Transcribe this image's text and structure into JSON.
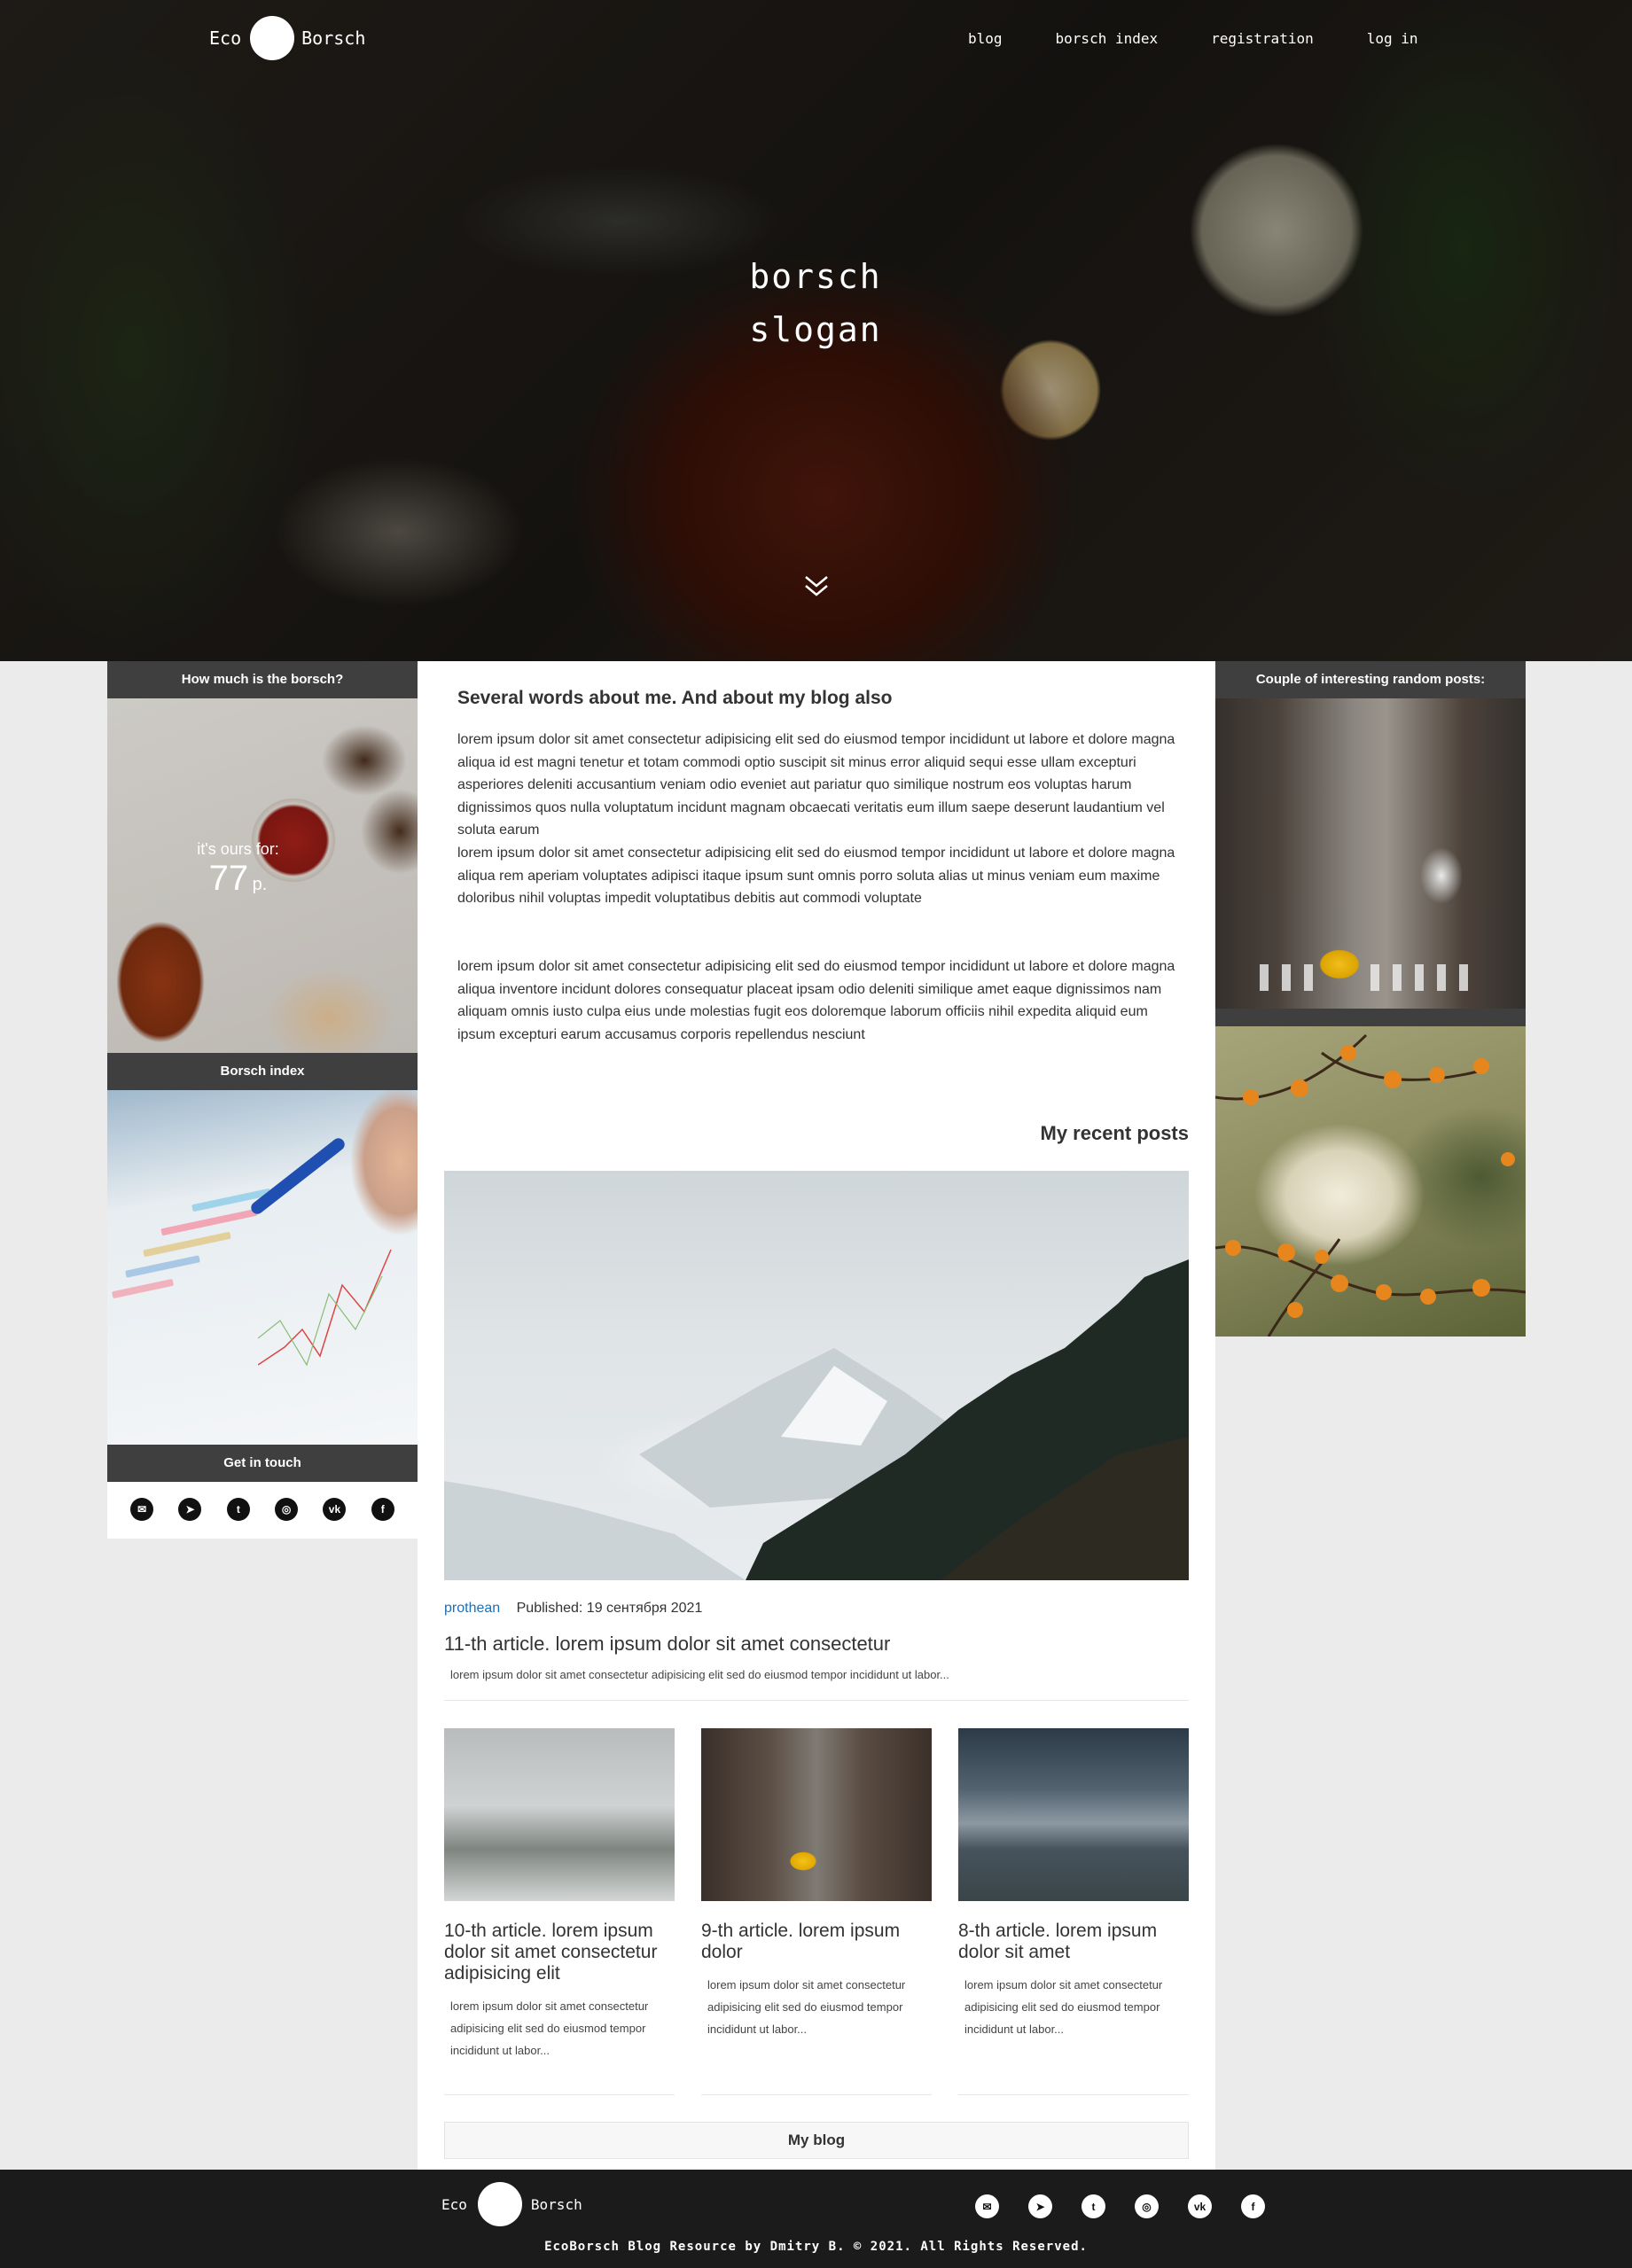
{
  "header": {
    "logo_left": "Eco",
    "logo_right": "Borsch",
    "nav": [
      "blog",
      "borsch index",
      "registration",
      "log in"
    ],
    "slogan_line1": "borsch",
    "slogan_line2": "slogan"
  },
  "left_sidebar": {
    "price_heading": "How much is the borsch?",
    "price_label": "it's ours for:",
    "price_value": "77",
    "price_currency": "p.",
    "index_heading": "Borsch index",
    "contact_heading": "Get in touch",
    "social_icons": [
      "mail-icon",
      "telegram-icon",
      "twitter-icon",
      "instagram-icon",
      "vk-icon",
      "facebook-icon"
    ]
  },
  "main": {
    "about_title": "Several words about me. And about my blog also",
    "paragraphs": [
      "lorem ipsum dolor sit amet consectetur adipisicing elit sed do eiusmod tempor incididunt ut labore et dolore magna aliqua id est magni tenetur et totam commodi optio suscipit sit minus error aliquid sequi esse ullam excepturi asperiores deleniti accusantium veniam odio eveniet aut pariatur quo similique nostrum eos voluptas harum dignissimos quos nulla voluptatum incidunt magnam obcaecati veritatis eum illum saepe deserunt laudantium vel soluta earum",
      "lorem ipsum dolor sit amet consectetur adipisicing elit sed do eiusmod tempor incididunt ut labore et dolore magna aliqua rem aperiam voluptates adipisci itaque ipsum sunt omnis porro soluta alias ut minus veniam eum maxime doloribus nihil voluptas impedit voluptatibus debitis aut commodi voluptate",
      "lorem ipsum dolor sit amet consectetur adipisicing elit sed do eiusmod tempor incididunt ut labore et dolore magna aliqua inventore incidunt dolores consequatur placeat ipsam odio deleniti similique amet eaque dignissimos nam aliquam omnis iusto culpa eius unde molestias fugit eos doloremque laborum officiis nihil expedita aliquid eum ipsum excepturi earum accusamus corporis repellendus nesciunt"
    ],
    "recent_title": "My recent posts",
    "featured": {
      "author": "prothean",
      "date": "Published: 19 сентября 2021",
      "title": "11-th article. lorem ipsum dolor sit amet consectetur",
      "excerpt": "lorem ipsum dolor sit amet consectetur adipisicing elit sed do eiusmod tempor incididunt ut labor..."
    },
    "cards": [
      {
        "title": "10-th article. lorem ipsum dolor sit amet consectetur adipisicing elit",
        "excerpt": "lorem ipsum dolor sit amet consectetur adipisicing elit sed do eiusmod tempor incididunt ut labor..."
      },
      {
        "title": "9-th article. lorem ipsum dolor",
        "excerpt": "lorem ipsum dolor sit amet consectetur adipisicing elit sed do eiusmod tempor incididunt ut labor..."
      },
      {
        "title": "8-th article. lorem ipsum dolor sit amet",
        "excerpt": "lorem ipsum dolor sit amet consectetur adipisicing elit sed do eiusmod tempor incididunt ut labor..."
      }
    ],
    "blog_button": "My blog"
  },
  "right_sidebar": {
    "heading": "Couple of interesting random posts:"
  },
  "footer": {
    "logo_left": "Eco",
    "logo_right": "Borsch",
    "copyright": "EcoBorsch Blog Resource by Dmitry B. © 2021. All Rights Reserved."
  },
  "colors": {
    "accent_link": "#1e6fb5",
    "sidebar_header": "#3f3f3f",
    "footer_bg": "#1b1b1b",
    "page_bg": "#ebebeb"
  }
}
